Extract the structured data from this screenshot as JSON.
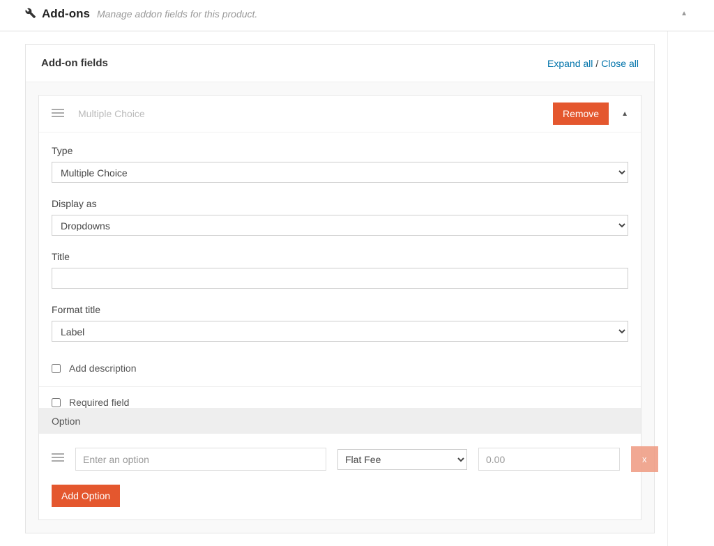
{
  "panel": {
    "title": "Add-ons",
    "subtitle": "Manage addon fields for this product."
  },
  "card": {
    "title": "Add-on fields",
    "expand_all": "Expand all",
    "close_all": "Close all"
  },
  "field": {
    "header_type": "Multiple Choice",
    "remove_label": "Remove",
    "labels": {
      "type": "Type",
      "display_as": "Display as",
      "title": "Title",
      "format_title": "Format title",
      "add_description": "Add description",
      "required_field": "Required field",
      "option": "Option"
    },
    "values": {
      "type": "Multiple Choice",
      "display_as": "Dropdowns",
      "title": "",
      "format_title": "Label"
    }
  },
  "option_row": {
    "placeholder": "Enter an option",
    "pricing_type": "Flat Fee",
    "price_placeholder": "0.00",
    "remove_x": "x"
  },
  "buttons": {
    "add_option": "Add Option"
  }
}
